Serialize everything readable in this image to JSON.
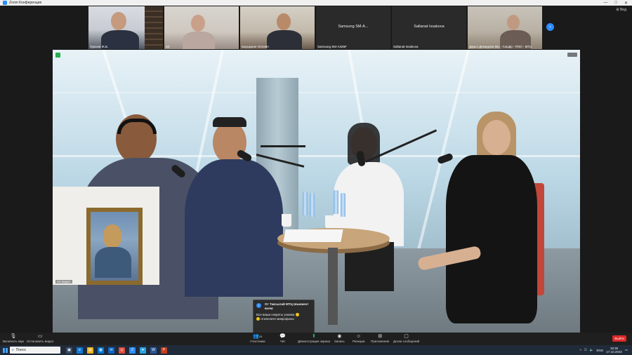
{
  "window": {
    "title": "Zoom Конференция",
    "controls": [
      "—",
      "□",
      "✕"
    ]
  },
  "view_button": "Вид",
  "participants_strip": [
    {
      "name": "Оразов Ж.Б.",
      "video": true
    },
    {
      "name": "3d",
      "video": true
    },
    {
      "name": "Бауыржан Онлайн",
      "video": true
    },
    {
      "name": "Samsung SM-A325F",
      "display": "Samsung SM-A...",
      "video": false
    },
    {
      "name": "Saltanat Issakova",
      "display": "Saltanat Issakova",
      "video": false
    },
    {
      "name": "Дарья Демидова МЦ - Альфр - РОО - МТЦ",
      "video": true
    }
  ],
  "self_view": {
    "name": "Не видео"
  },
  "chat_notification": {
    "avatar_letter": "Т",
    "from": "От Таксылай МТЦ Шымкент всем:",
    "message": "Все ваши секреты узнаем",
    "message2": "отключите микрофоны"
  },
  "toolbar": {
    "left": [
      {
        "icon": "mic-icon",
        "label": "Включить звук"
      },
      {
        "icon": "video-icon",
        "label": "Остановить видео"
      }
    ],
    "center": [
      {
        "icon": "participants-icon",
        "label": "Участники",
        "count": "24"
      },
      {
        "icon": "chat-icon",
        "label": "Чат"
      },
      {
        "icon": "share-screen-icon",
        "label": "Демонстрация экрана"
      },
      {
        "icon": "record-icon",
        "label": "Запись"
      },
      {
        "icon": "reactions-icon",
        "label": "Реакции"
      },
      {
        "icon": "apps-icon",
        "label": "Приложения"
      },
      {
        "icon": "whiteboard-icon",
        "label": "Доски сообщений"
      }
    ],
    "leave_label": "Выйти"
  },
  "taskbar": {
    "search_placeholder": "Поиск",
    "tray": {
      "lang": "ENG",
      "time": "18:39",
      "date": "17.10.2023"
    }
  },
  "colors": {
    "accent": "#2d8cff",
    "leave": "#e02828",
    "chrome": "#1f1f1f"
  }
}
